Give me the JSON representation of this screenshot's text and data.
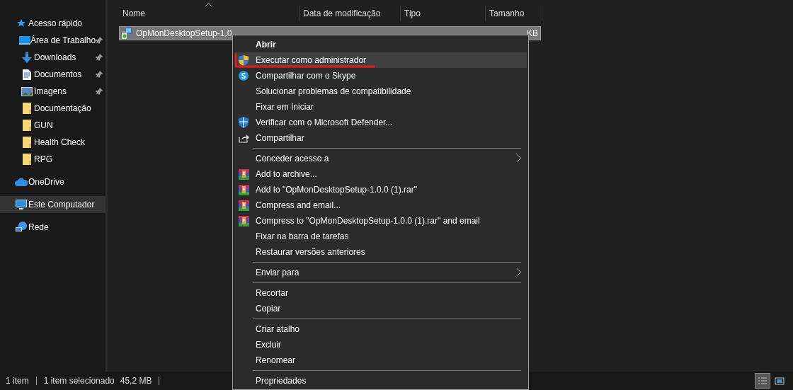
{
  "sidebar": {
    "sections": [
      {
        "label": "Acesso rápido",
        "kind": "star",
        "selected": false,
        "children": [
          {
            "label": "Área de Trabalho",
            "kind": "desktop",
            "pinned": true,
            "selected": false
          },
          {
            "label": "Downloads",
            "kind": "download",
            "pinned": true,
            "selected": false
          },
          {
            "label": "Documentos",
            "kind": "document",
            "pinned": true,
            "selected": false
          },
          {
            "label": "Imagens",
            "kind": "image",
            "pinned": true,
            "selected": false
          },
          {
            "label": "Documentação",
            "kind": "folder",
            "pinned": false,
            "selected": false
          },
          {
            "label": "GUN",
            "kind": "folder",
            "pinned": false,
            "selected": false
          },
          {
            "label": "Health Check",
            "kind": "folder",
            "pinned": false,
            "selected": false
          },
          {
            "label": "RPG",
            "kind": "folder",
            "pinned": false,
            "selected": false
          }
        ]
      },
      {
        "label": "OneDrive",
        "kind": "cloud",
        "selected": false
      },
      {
        "label": "Este Computador",
        "kind": "computer",
        "selected": true
      },
      {
        "label": "Rede",
        "kind": "network",
        "selected": false
      }
    ]
  },
  "file_list": {
    "columns": [
      {
        "label": "Nome",
        "sorted": true
      },
      {
        "label": "Data de modificação",
        "sorted": false
      },
      {
        "label": "Tipo",
        "sorted": false
      },
      {
        "label": "Tamanho",
        "sorted": false
      }
    ],
    "rows": [
      {
        "name": "OpMonDesktopSetup-1.0",
        "size": "KB",
        "selected": true
      }
    ]
  },
  "context_menu": {
    "items": [
      {
        "kind": "plain",
        "label": "Abrir",
        "default": true,
        "selected": false,
        "underlined": false
      },
      {
        "kind": "shield",
        "label": "Executar como administrador",
        "default": false,
        "selected": true,
        "underlined": true
      },
      {
        "kind": "skype",
        "label": "Compartilhar com o Skype",
        "default": false,
        "selected": false,
        "underlined": false
      },
      {
        "kind": "plain",
        "label": "Solucionar problemas de compatibilidade",
        "default": false,
        "selected": false,
        "underlined": false
      },
      {
        "kind": "plain",
        "label": "Fixar em Iniciar",
        "default": false,
        "selected": false,
        "underlined": false
      },
      {
        "kind": "defender",
        "label": "Verificar com o Microsoft Defender...",
        "default": false,
        "selected": false,
        "underlined": false
      },
      {
        "kind": "share",
        "label": "Compartilhar",
        "default": false,
        "selected": false,
        "underlined": false
      },
      {
        "kind": "separator"
      },
      {
        "kind": "submenu",
        "label": "Conceder acesso a",
        "default": false,
        "selected": false,
        "underlined": false
      },
      {
        "kind": "archive",
        "label": "Add to archive...",
        "default": false,
        "selected": false,
        "underlined": false
      },
      {
        "kind": "archive",
        "label": "Add to \"OpMonDesktopSetup-1.0.0 (1).rar\"",
        "default": false,
        "selected": false,
        "underlined": false
      },
      {
        "kind": "archive",
        "label": "Compress and email...",
        "default": false,
        "selected": false,
        "underlined": false
      },
      {
        "kind": "archive",
        "label": "Compress to \"OpMonDesktopSetup-1.0.0 (1).rar\" and email",
        "default": false,
        "selected": false,
        "underlined": false
      },
      {
        "kind": "plain",
        "label": "Fixar na barra de tarefas",
        "default": false,
        "selected": false,
        "underlined": false
      },
      {
        "kind": "plain",
        "label": "Restaurar versões anteriores",
        "default": false,
        "selected": false,
        "underlined": false
      },
      {
        "kind": "separator"
      },
      {
        "kind": "submenu",
        "label": "Enviar para",
        "default": false,
        "selected": false,
        "underlined": false
      },
      {
        "kind": "separator"
      },
      {
        "kind": "plain",
        "label": "Recortar",
        "default": false,
        "selected": false,
        "underlined": false
      },
      {
        "kind": "plain",
        "label": "Copiar",
        "default": false,
        "selected": false,
        "underlined": false
      },
      {
        "kind": "separator"
      },
      {
        "kind": "plain",
        "label": "Criar atalho",
        "default": false,
        "selected": false,
        "underlined": false
      },
      {
        "kind": "plain",
        "label": "Excluir",
        "default": false,
        "selected": false,
        "underlined": false
      },
      {
        "kind": "plain",
        "label": "Renomear",
        "default": false,
        "selected": false,
        "underlined": false
      },
      {
        "kind": "separator"
      },
      {
        "kind": "plain",
        "label": "Propriedades",
        "default": false,
        "selected": false,
        "underlined": false
      }
    ]
  },
  "status_bar": {
    "item_count": "1 item",
    "selection": "1 item selecionado",
    "size": "45,2 MB",
    "views": [
      {
        "kind": "details",
        "selected": true
      },
      {
        "kind": "tiles",
        "selected": false
      }
    ]
  }
}
